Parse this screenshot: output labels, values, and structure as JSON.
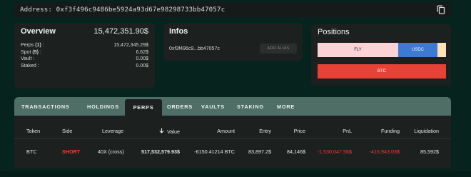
{
  "address": {
    "text": "Address: 0xf3f496c9486be5924a93d67e98298733bb47057c",
    "copy_icon": "copy-icon"
  },
  "overview": {
    "title": "Overview",
    "total": "15,472,351.90$",
    "rows": [
      {
        "label": "Perps",
        "count": "(1)",
        "suffix": ":",
        "value": "15,472,345.29$"
      },
      {
        "label": "Spot",
        "count": "(5)",
        "suffix": ":",
        "value": "6.62$"
      },
      {
        "label": "Vault :",
        "value": "0.00$"
      },
      {
        "label": "Staked :",
        "value": "0.00$"
      }
    ]
  },
  "infos": {
    "title": "Infos",
    "short_address": "0xf3f496c9...bb47057c",
    "alias_button": "ADD ALIAS"
  },
  "positions": {
    "title": "Positions",
    "bar": [
      {
        "label": "FLY",
        "color": "#fbd3d7"
      },
      {
        "label": "USDC",
        "color": "#3c7bd1"
      },
      {
        "label": "",
        "color": "#fde1b8"
      }
    ],
    "btc": {
      "label": "BTC",
      "color": "#e74238"
    }
  },
  "tabs": [
    "TRANSACTIONS",
    "HOLDINGS",
    "PERPS",
    "ORDERS",
    "VAULTS",
    "STAKING",
    "MORE"
  ],
  "active_tab": "PERPS",
  "table": {
    "headers": [
      "Token",
      "Side",
      "Leverage",
      "Value",
      "Amount",
      "Entry",
      "Price",
      "PnL",
      "Funding",
      "Liquidation"
    ],
    "sort_icon": "arrow-down-icon",
    "rows": [
      {
        "token": "BTC",
        "side": "SHORT",
        "leverage": "40X (cross)",
        "value": "517,532,579.93$",
        "amount": "-6150.41214 BTC",
        "entry": "83,897.2$",
        "price": "84,146$",
        "pnl": "-1,530,047.56$",
        "funding": "-416,943.03$",
        "liquidation": "85,592$"
      }
    ]
  },
  "colors": {
    "background": "#06231d",
    "card": "#1c201f",
    "tab_bar": "#4e6e66",
    "negative": "#f03d37"
  }
}
